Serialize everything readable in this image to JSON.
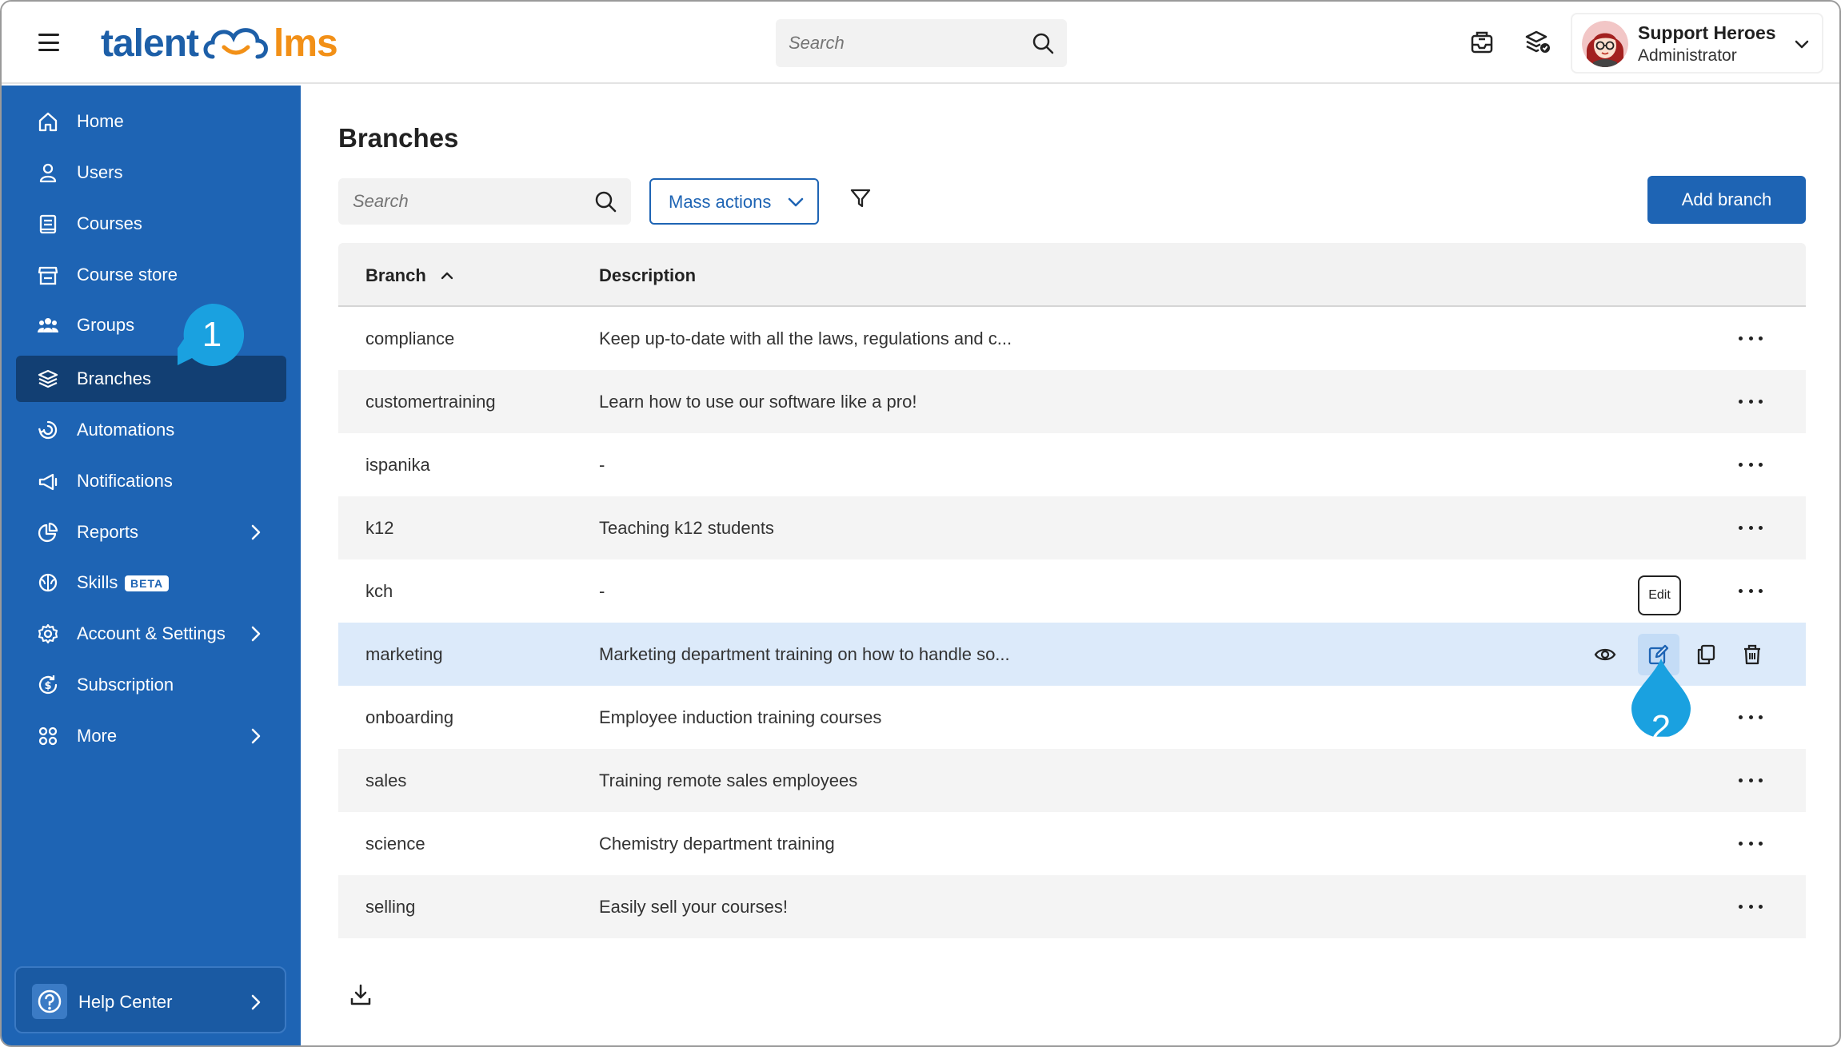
{
  "app": {
    "logo_left": "talent",
    "logo_right": "lms"
  },
  "topbar": {
    "search_placeholder": "Search",
    "user_name": "Support Heroes",
    "user_role": "Administrator"
  },
  "sidebar": {
    "items": [
      {
        "label": "Home",
        "icon": "home-icon"
      },
      {
        "label": "Users",
        "icon": "user-icon"
      },
      {
        "label": "Courses",
        "icon": "book-icon"
      },
      {
        "label": "Course store",
        "icon": "store-icon"
      },
      {
        "label": "Groups",
        "icon": "groups-icon"
      },
      {
        "label": "Branches",
        "icon": "layers-icon",
        "active": true
      },
      {
        "label": "Automations",
        "icon": "automation-icon"
      },
      {
        "label": "Notifications",
        "icon": "megaphone-icon"
      },
      {
        "label": "Reports",
        "icon": "pie-chart-icon",
        "has_children": true
      },
      {
        "label": "Skills",
        "icon": "brain-icon",
        "badge": "BETA"
      },
      {
        "label": "Account & Settings",
        "icon": "gear-icon",
        "has_children": true
      },
      {
        "label": "Subscription",
        "icon": "subscription-icon"
      },
      {
        "label": "More",
        "icon": "grid-icon",
        "has_children": true
      }
    ],
    "help_label": "Help Center"
  },
  "main": {
    "title": "Branches",
    "search_placeholder": "Search",
    "mass_actions_label": "Mass actions",
    "add_button_label": "Add branch",
    "columns": {
      "branch": "Branch",
      "description": "Description"
    },
    "rows": [
      {
        "branch": "compliance",
        "description": "Keep up-to-date with all the laws, regulations and c..."
      },
      {
        "branch": "customertraining",
        "description": "Learn how to use our software like a pro!"
      },
      {
        "branch": "ispanika",
        "description": "-"
      },
      {
        "branch": "k12",
        "description": "Teaching k12 students"
      },
      {
        "branch": "kch",
        "description": "-"
      },
      {
        "branch": "marketing",
        "description": "Marketing department training on how to handle so...",
        "hovered": true
      },
      {
        "branch": "onboarding",
        "description": "Employee induction training courses"
      },
      {
        "branch": "sales",
        "description": "Training remote sales employees"
      },
      {
        "branch": "science",
        "description": "Chemistry department training"
      },
      {
        "branch": "selling",
        "description": "Easily sell your courses!"
      }
    ],
    "tooltip": "Edit"
  },
  "callouts": {
    "one": "1",
    "two": "2"
  },
  "colors": {
    "sidebar_bg": "#1e64b4",
    "sidebar_active": "#123f73",
    "accent": "#1e64b4",
    "logo_orange": "#f29017",
    "callout": "#1aa1e0",
    "row_highlight": "#dceafa"
  }
}
